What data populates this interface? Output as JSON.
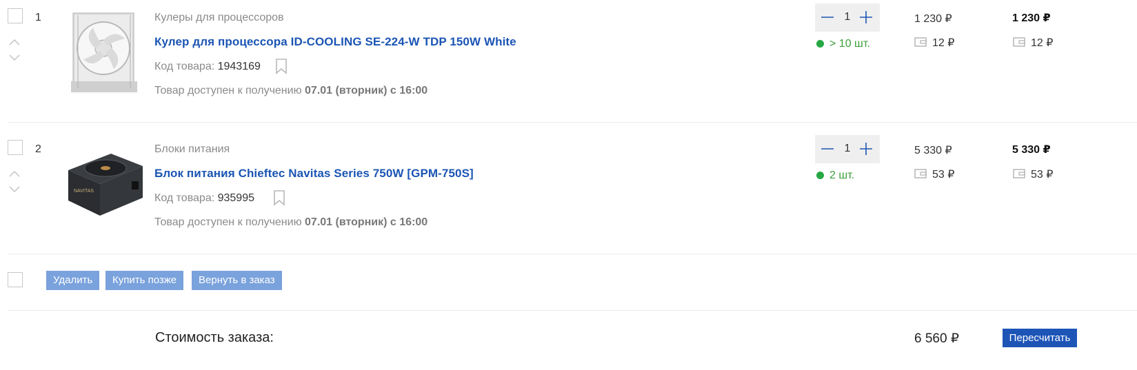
{
  "items": [
    {
      "index": "1",
      "category": "Кулеры для процессоров",
      "title": "Кулер для процессора ID-COOLING SE-224-W TDP 150W White",
      "code_label": "Код товара:",
      "code": "1943169",
      "availability_prefix": "Товар доступен к получению",
      "availability_date": "07.01 (вторник) с 16:00",
      "quantity": "1",
      "stock": "> 10 шт.",
      "price": "1 230 ₽",
      "total": "1 230 ₽",
      "bonus": "12 ₽",
      "bonus_total": "12 ₽",
      "image_icon": "cpu-cooler-image"
    },
    {
      "index": "2",
      "category": "Блоки питания",
      "title": "Блок питания Chieftec Navitas Series 750W [GPM-750S]",
      "code_label": "Код товара:",
      "code": "935995",
      "availability_prefix": "Товар доступен к получению",
      "availability_date": "07.01 (вторник) с 16:00",
      "quantity": "1",
      "stock": "2 шт.",
      "price": "5 330 ₽",
      "total": "5 330 ₽",
      "bonus": "53 ₽",
      "bonus_total": "53 ₽",
      "image_icon": "power-supply-image"
    }
  ],
  "actions": {
    "delete": "Удалить",
    "buy_later": "Купить позже",
    "return_to_order": "Вернуть в заказ"
  },
  "footer": {
    "label": "Стоимость заказа:",
    "sum": "6 560 ₽",
    "recalc": "Пересчитать"
  },
  "colors": {
    "link": "#1b55b4",
    "stock_green": "#27a845",
    "action_button": "#7aa2dc",
    "primary_button": "#1d55b7",
    "qty_bg": "#efefef"
  }
}
